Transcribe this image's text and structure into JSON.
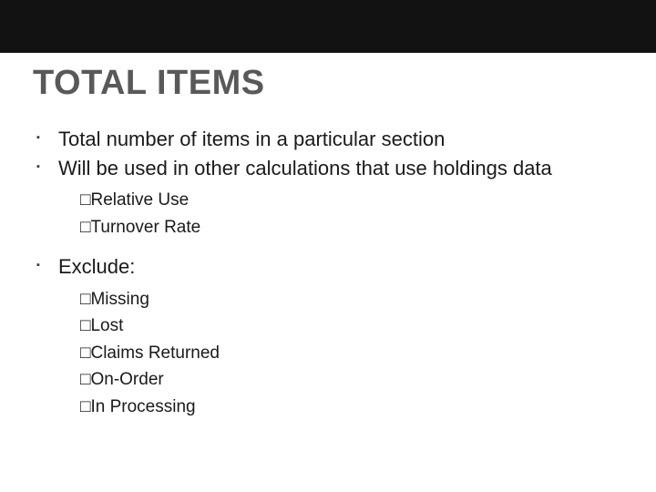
{
  "title": "TOTAL ITEMS",
  "box_glyph": "□",
  "bullets": [
    {
      "text": "Total number of items in a particular section"
    },
    {
      "text": "Will be used in other calculations that use holdings data",
      "sub": [
        "Relative Use",
        "Turnover Rate"
      ]
    },
    {
      "text": "Exclude:",
      "sub": [
        "Missing",
        "Lost",
        "Claims Returned",
        "On-Order",
        "In Processing"
      ]
    }
  ]
}
